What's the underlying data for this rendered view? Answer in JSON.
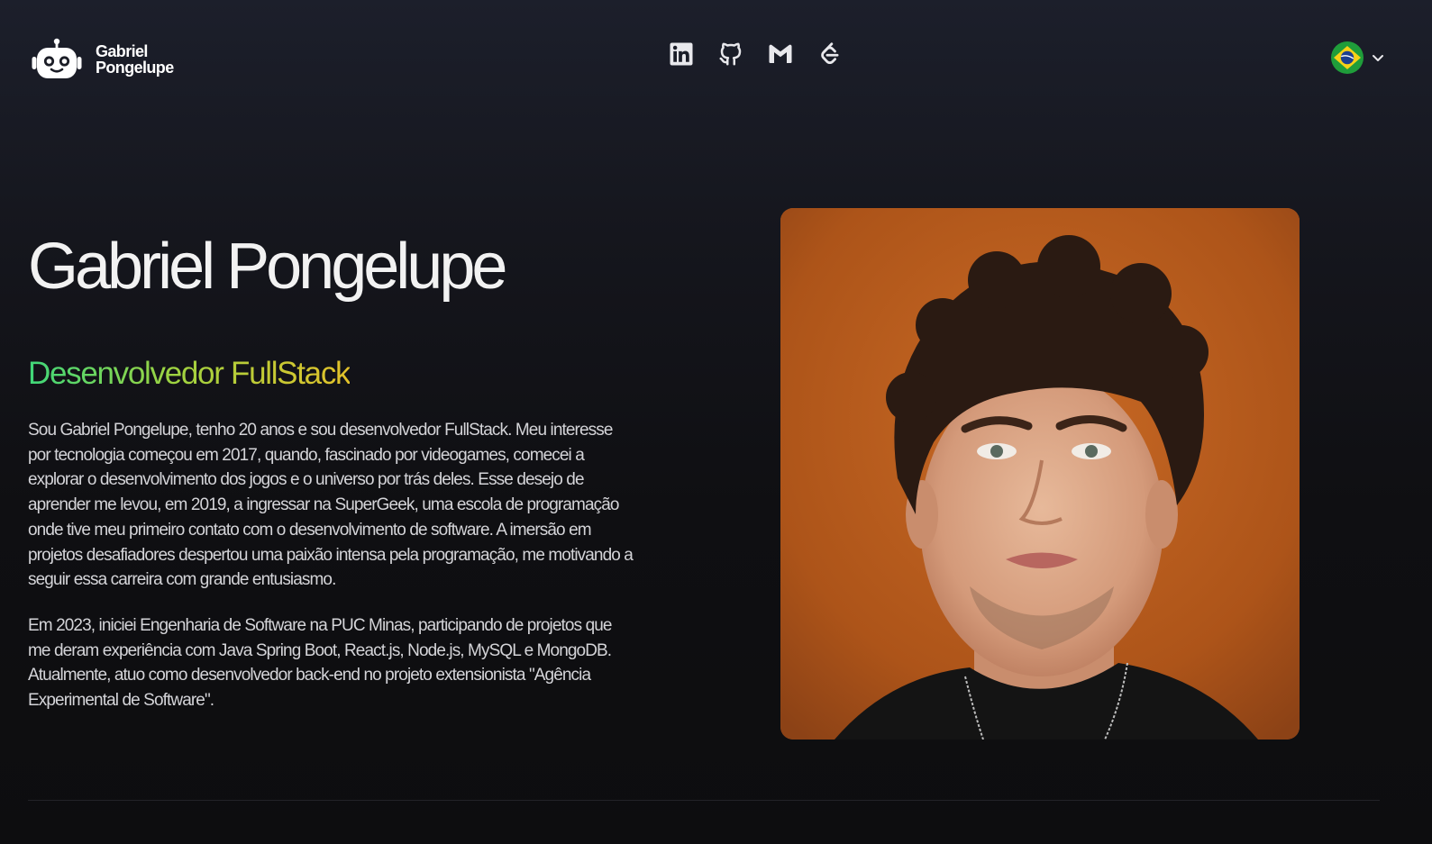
{
  "header": {
    "brand": {
      "line1": "Gabriel",
      "line2": "Pongelupe",
      "logo_icon": "robot-icon"
    },
    "socials": [
      {
        "name": "LinkedIn",
        "icon": "linkedin-icon"
      },
      {
        "name": "GitHub",
        "icon": "github-icon"
      },
      {
        "name": "Gmail",
        "icon": "gmail-icon"
      },
      {
        "name": "LeetCode",
        "icon": "leetcode-icon"
      }
    ],
    "language": {
      "selected": "Português (Brasil)",
      "flag": "brazil-flag-icon",
      "chevron": "chevron-down-icon"
    }
  },
  "hero": {
    "name": "Gabriel Pongelupe",
    "role": "Desenvolvedor FullStack",
    "paragraphs": [
      "Sou Gabriel Pongelupe, tenho 20 anos e sou desenvolvedor FullStack. Meu interesse por tecnologia começou em 2017, quando, fascinado por videogames, comecei a explorar o desenvolvimento dos jogos e o universo por trás deles. Esse desejo de aprender me levou, em 2019, a ingressar na SuperGeek, uma escola de programação onde tive meu primeiro contato com o desenvolvimento de software. A imersão em projetos desafiadores despertou uma paixão intensa pela programação, me motivando a seguir essa carreira com grande entusiasmo.",
      "Em 2023, iniciei Engenharia de Software na PUC Minas, participando de projetos que me deram experiência com Java Spring Boot, React.js, Node.js, MySQL e MongoDB. Atualmente, atuo como desenvolvedor back-end no projeto extensionista \"Agência Experimental de Software\"."
    ]
  },
  "colors": {
    "background": "#0d0d0f",
    "header_gradient_top": "#1c1f2b",
    "role_gradient": [
      "#3fd77a",
      "#9ed341",
      "#e3c22a"
    ],
    "photo_background": "#b0551b"
  }
}
